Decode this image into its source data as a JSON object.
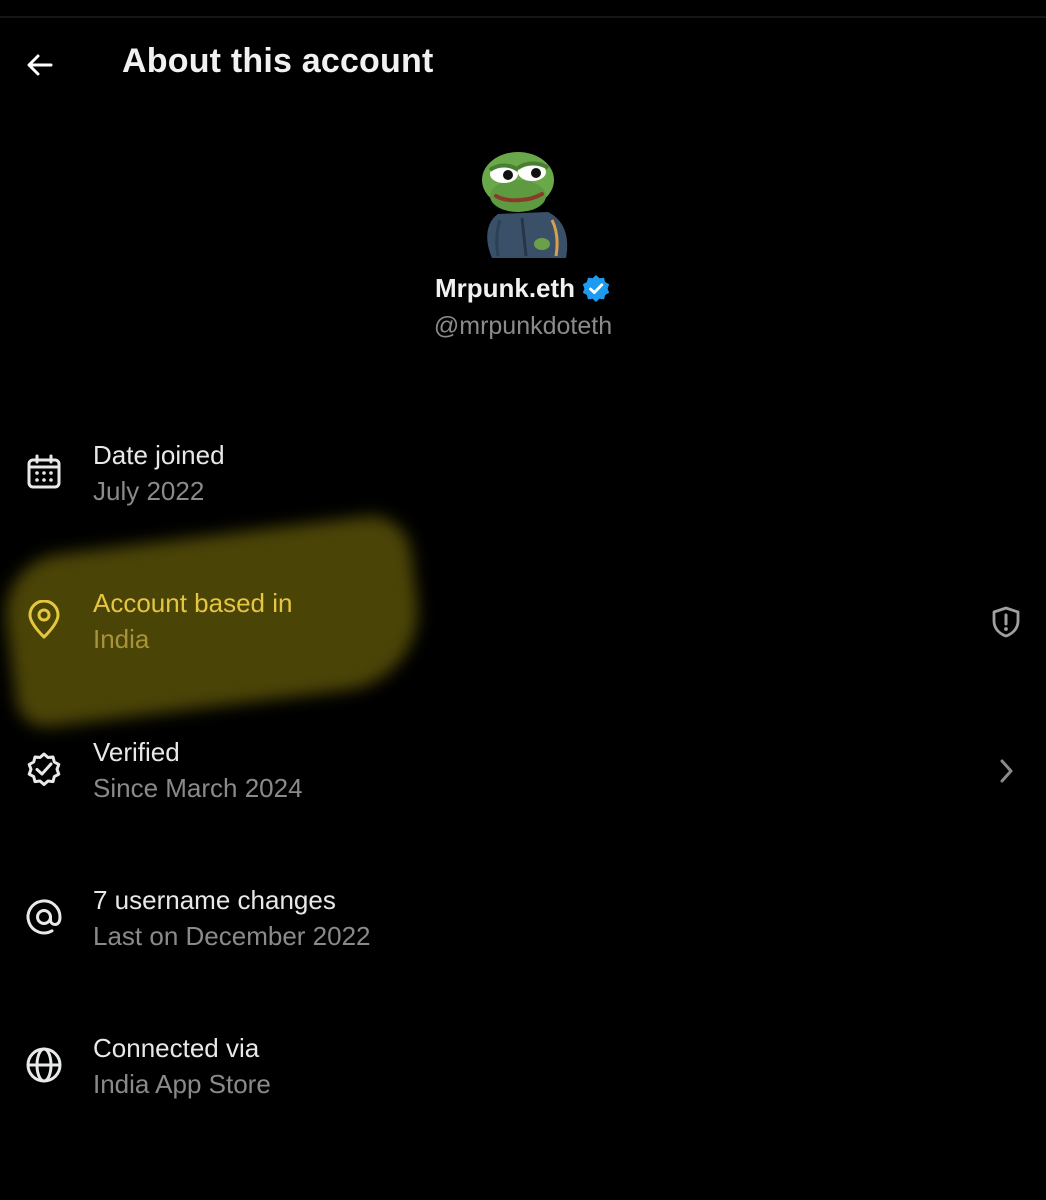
{
  "header": {
    "title": "About this account",
    "back_icon": "arrow-left-icon"
  },
  "profile": {
    "display_name": "Mrpunk.eth",
    "handle": "@mrpunkdoteth",
    "verified": true,
    "badge_color": "#1d9bf0",
    "avatar_icon": "pepe-frog-avatar"
  },
  "rows": [
    {
      "icon": "calendar-icon",
      "title": "Date joined",
      "value": "July 2022"
    },
    {
      "icon": "location-pin-icon",
      "title": "Account based in",
      "value": "India",
      "trailing_icon": "shield-alert-icon",
      "highlighted": true,
      "highlight_color": "#e5c640"
    },
    {
      "icon": "verified-check-icon",
      "title": "Verified",
      "value": "Since March 2024",
      "trailing_icon": "chevron-right-icon"
    },
    {
      "icon": "at-sign-icon",
      "title": "7 username changes",
      "value": "Last on December 2022"
    },
    {
      "icon": "globe-icon",
      "title": "Connected via",
      "value": "India App Store"
    }
  ],
  "colors": {
    "background": "#000000",
    "primary_text": "#e7e9ea",
    "secondary_text": "#8a8a8a",
    "highlight": "#e5c640"
  }
}
